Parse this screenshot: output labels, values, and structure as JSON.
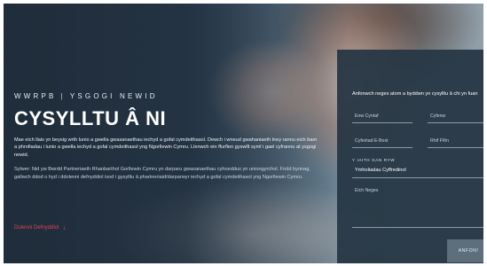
{
  "hero": {
    "eyebrow_left": "WWRPB",
    "eyebrow_sep": "|",
    "eyebrow_right": "YSGOGI NEWID",
    "title": "CYSYLLTU Â NI",
    "paragraph1": "Mae eich llais yn beysig wrth lunio a gwella gwasanaethau iechyd a gofal cymdeithasol. Dewch i wneud gwahaniaeth trwy rannu eich barn a phrofiadau i lunio a gwella iechyd a gofal cymdeithasol yng Ngorllewin Cymru. Llenwch ein ffurflen gyswllt syml i gael cyfrannu at ysgogi newid.",
    "paragraph2": "Sylwer: Nid yw Bwrdd Partneriaeth Rhanbarthol Gorllewin Cymru yn darparu gwasanaethau cyhoeddus yn uniongyrchol. Fodd bynnag, gallwch ddod o hyd i ddolenni defnyddiol isod i gysylltu â phartneriaid/darparwyr iechyd a gofal cymdeithasol yng Ngorllewin Cymru.",
    "read_more": "Dolenni Defnyddiol",
    "read_more_icon": "arrow-down-icon"
  },
  "form": {
    "intro": "Anfonwch neges atom a byddwn yn cysylltu â chi yn fuan",
    "first_name_placeholder": "Enw Cyntaf",
    "last_name_placeholder": "Cyfenw",
    "email_placeholder": "Cyfeiriad E-Bost",
    "phone_placeholder": "Rhif Ffôn",
    "language_label": "Y IAITH GAN RYW",
    "language_value": "Ymholiadau Cyffredinol",
    "message_placeholder": "Eich Neges",
    "send_label": "ANFON!"
  },
  "colors": {
    "overlay": "#1f2c3a",
    "panel": "#263644",
    "accent_red": "#e0434f",
    "button": "#5d6f7d"
  }
}
